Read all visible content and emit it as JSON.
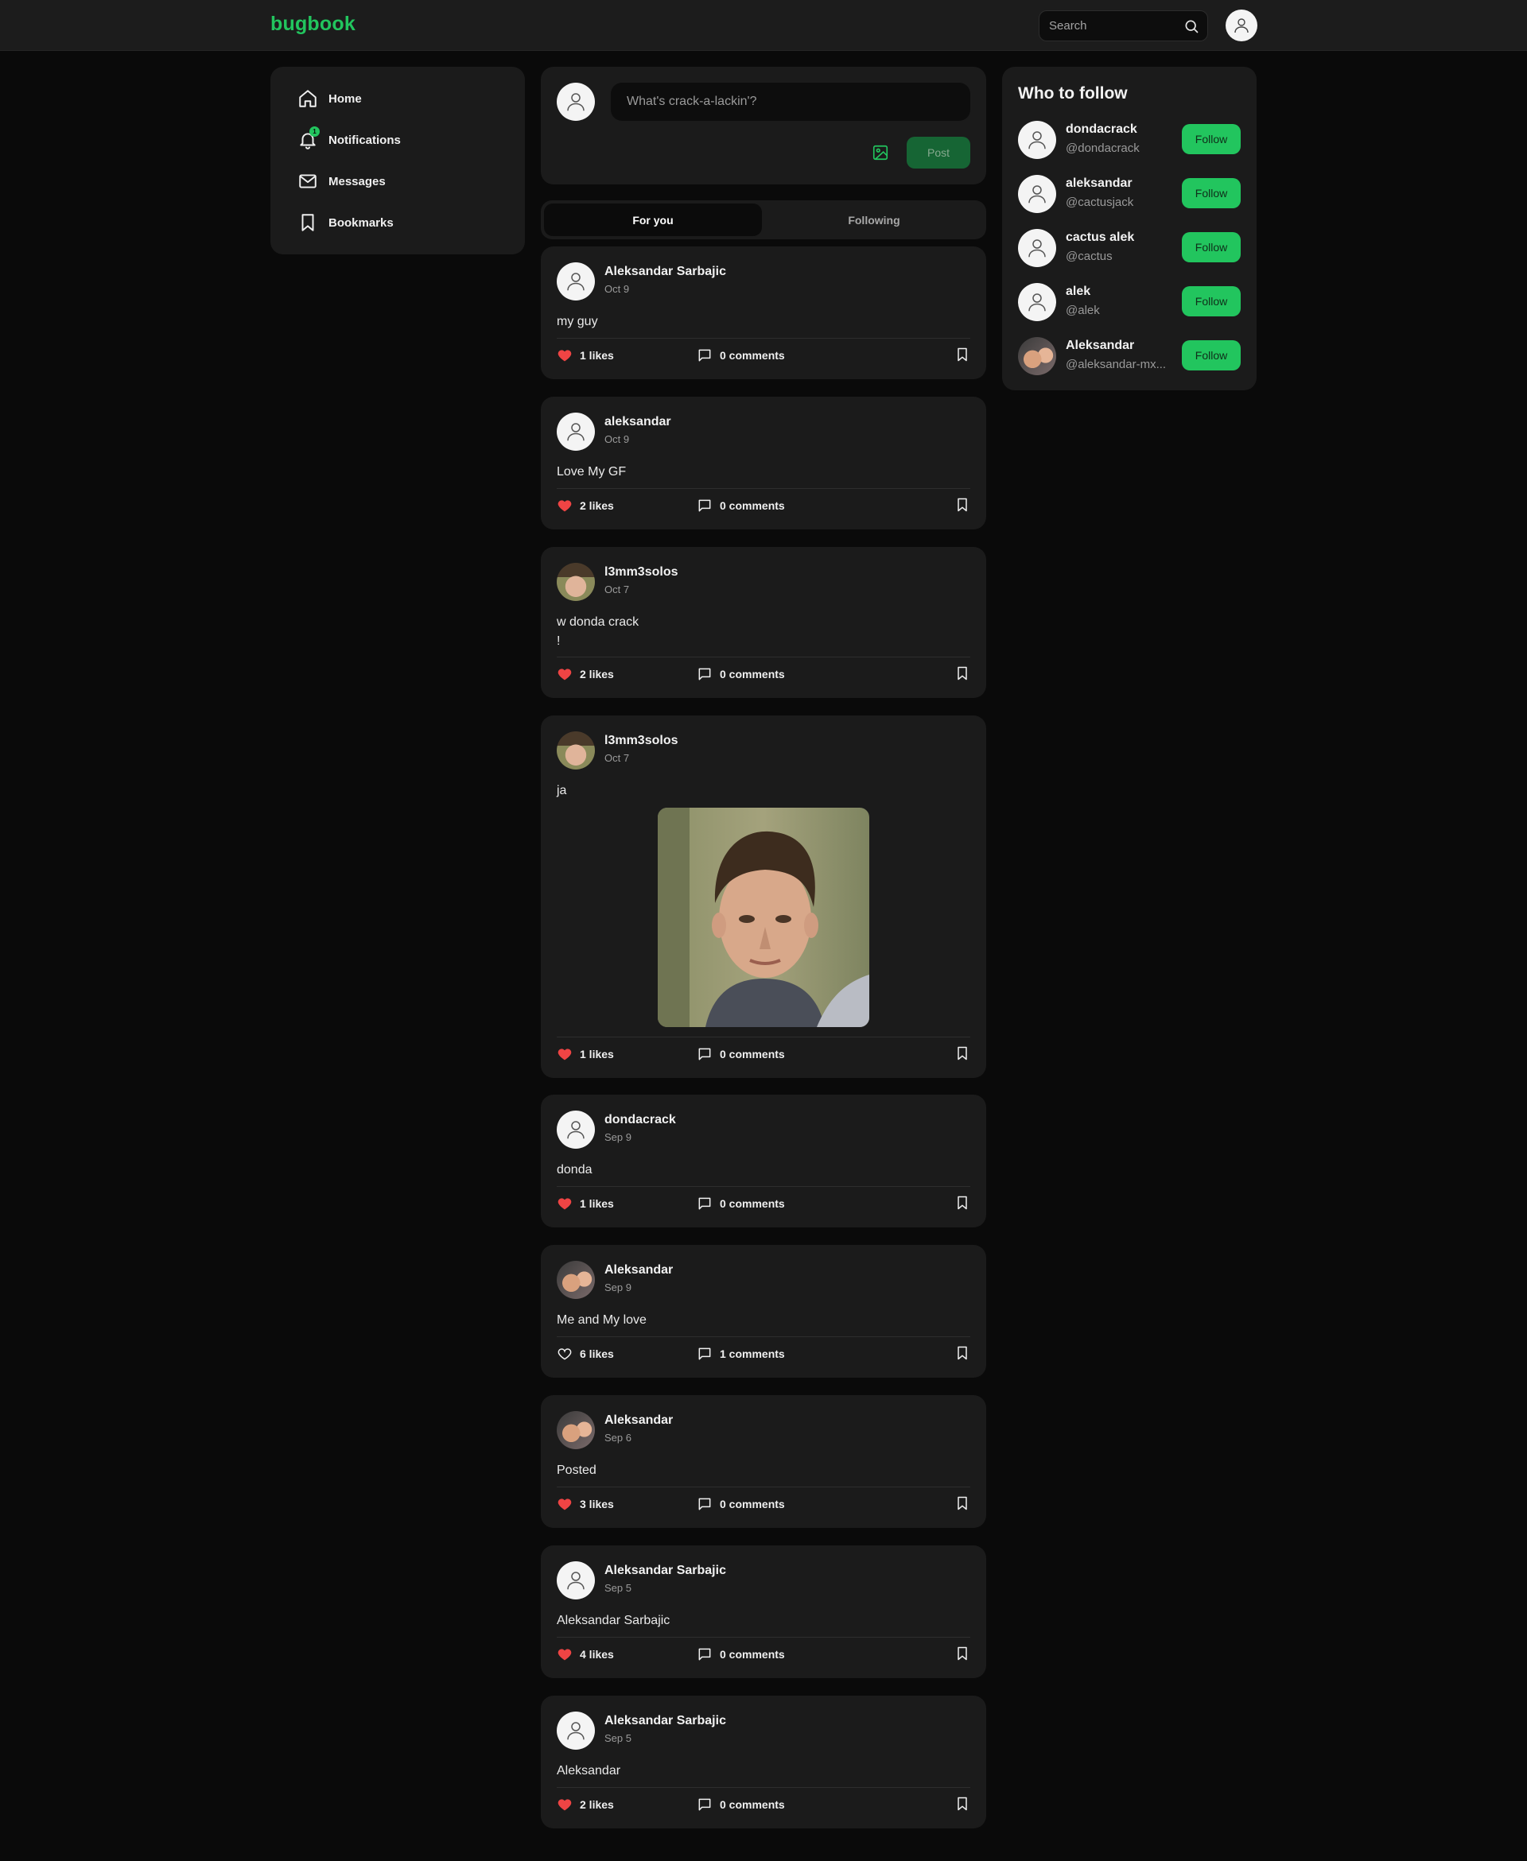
{
  "app": {
    "logo": "bugbook"
  },
  "header": {
    "search": {
      "placeholder": "Search",
      "value": ""
    },
    "avatar_icon": "user-icon"
  },
  "sidebar": {
    "items": [
      {
        "label": "Home",
        "icon": "home-icon"
      },
      {
        "label": "Notifications",
        "icon": "bell-icon",
        "badge": "1"
      },
      {
        "label": "Messages",
        "icon": "mail-icon"
      },
      {
        "label": "Bookmarks",
        "icon": "bookmark-icon"
      }
    ]
  },
  "composer": {
    "placeholder": "What's crack-a-lackin'?",
    "post_label": "Post",
    "image_icon": "image-icon"
  },
  "tabs": [
    {
      "label": "For you",
      "active": true
    },
    {
      "label": "Following",
      "active": false
    }
  ],
  "posts": [
    {
      "author": "Aleksandar Sarbajic",
      "date": "Oct 9",
      "body": "my guy",
      "likes": "1 likes",
      "liked": true,
      "comments": "0 comments",
      "avatar": "default"
    },
    {
      "author": "aleksandar",
      "date": "Oct 9",
      "body": "Love My GF",
      "likes": "2 likes",
      "liked": true,
      "comments": "0 comments",
      "avatar": "default"
    },
    {
      "author": "l3mm3solos",
      "date": "Oct 7",
      "body": "w donda crack\n!",
      "likes": "2 likes",
      "liked": true,
      "comments": "0 comments",
      "avatar": "photo"
    },
    {
      "author": "l3mm3solos",
      "date": "Oct 7",
      "body": "ja",
      "likes": "1 likes",
      "liked": true,
      "comments": "0 comments",
      "avatar": "photo",
      "has_image": true
    },
    {
      "author": "dondacrack",
      "date": "Sep 9",
      "body": "donda",
      "likes": "1 likes",
      "liked": true,
      "comments": "0 comments",
      "avatar": "default"
    },
    {
      "author": "Aleksandar",
      "date": "Sep 9",
      "body": "Me and My love",
      "likes": "6 likes",
      "liked": false,
      "comments": "1 comments",
      "avatar": "photo"
    },
    {
      "author": "Aleksandar",
      "date": "Sep 6",
      "body": "Posted",
      "likes": "3 likes",
      "liked": true,
      "comments": "0 comments",
      "avatar": "photo"
    },
    {
      "author": "Aleksandar Sarbajic",
      "date": "Sep 5",
      "body": "Aleksandar Sarbajic",
      "likes": "4 likes",
      "liked": true,
      "comments": "0 comments",
      "avatar": "default"
    },
    {
      "author": "Aleksandar Sarbajic",
      "date": "Sep 5",
      "body": "Aleksandar",
      "likes": "2 likes",
      "liked": true,
      "comments": "0 comments",
      "avatar": "default"
    }
  ],
  "who_to_follow": {
    "title": "Who to follow",
    "users": [
      {
        "name": "dondacrack",
        "handle": "@dondacrack",
        "button": "Follow",
        "avatar": "default"
      },
      {
        "name": "aleksandar",
        "handle": "@cactusjack",
        "button": "Follow",
        "avatar": "default"
      },
      {
        "name": "cactus alek",
        "handle": "@cactus",
        "button": "Follow",
        "avatar": "default"
      },
      {
        "name": "alek",
        "handle": "@alek",
        "button": "Follow",
        "avatar": "default"
      },
      {
        "name": "Aleksandar",
        "handle": "@aleksandar-mx...",
        "button": "Follow",
        "avatar": "photo"
      }
    ]
  },
  "colors": {
    "accent": "#22c55e",
    "background": "#0a0a0a",
    "card": "#1b1b1b",
    "like": "#ef4444"
  }
}
